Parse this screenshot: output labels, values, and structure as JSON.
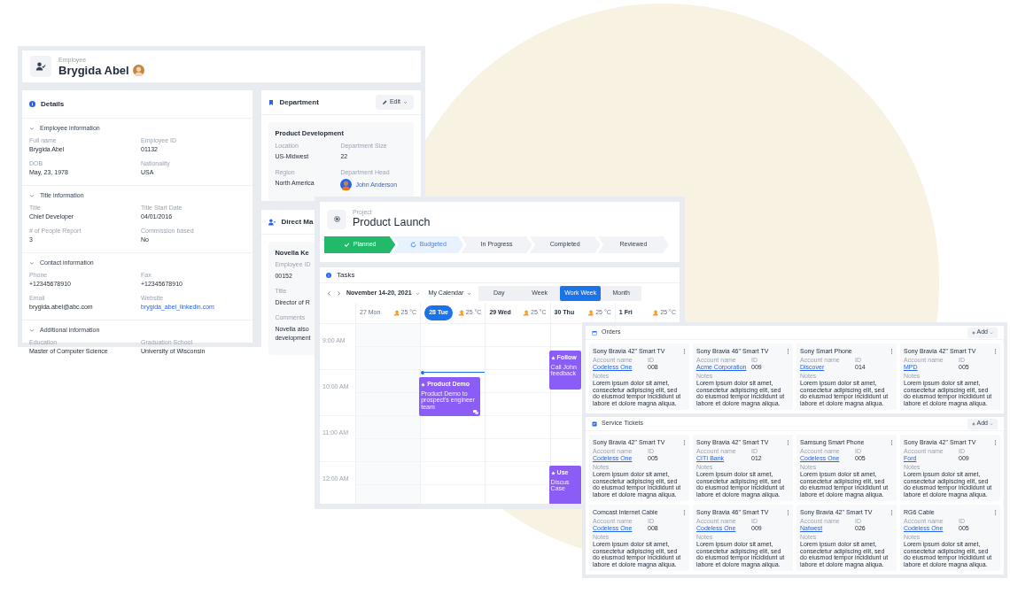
{
  "employee": {
    "label": "Employee",
    "name": "Brygida Abel",
    "details": {
      "title": "Details",
      "sections": [
        {
          "title": "Employee information",
          "expanded": true,
          "fields": [
            {
              "label": "Full name",
              "value": "Brygida Abel",
              "kind": "text"
            },
            {
              "label": "Employee ID",
              "value": "01132",
              "kind": "text"
            },
            {
              "label": "DOB",
              "value": "May, 23, 1978",
              "kind": "text"
            },
            {
              "label": "Nationality",
              "value": "USA",
              "kind": "text"
            }
          ]
        },
        {
          "title": "Title information",
          "expanded": true,
          "fields": [
            {
              "label": "Title",
              "value": "Chief Developer",
              "kind": "text"
            },
            {
              "label": "Title Start Date",
              "value": "04/01/2016",
              "kind": "text"
            },
            {
              "label": "# of People Report",
              "value": "3",
              "kind": "text"
            },
            {
              "label": "Commission based",
              "value": "No",
              "kind": "text"
            }
          ]
        },
        {
          "title": "Contact information",
          "expanded": true,
          "fields": [
            {
              "label": "Phone",
              "value": "+12345678910",
              "kind": "text"
            },
            {
              "label": "Fax",
              "value": "+12345678910",
              "kind": "text"
            },
            {
              "label": "Email",
              "value": "brygida.abel@abc.com",
              "kind": "text"
            },
            {
              "label": "Website",
              "value": "brygida_abel_linkedin.com",
              "kind": "link"
            }
          ]
        },
        {
          "title": "Additional information",
          "expanded": true,
          "fields": [
            {
              "label": "Education",
              "value": "Master of Computer Science",
              "kind": "text"
            },
            {
              "label": "Graduation School",
              "value": "University of Wisconsin",
              "kind": "text"
            }
          ]
        }
      ]
    },
    "department": {
      "title": "Department",
      "edit": "Edit",
      "name": "Product Development",
      "fields": [
        {
          "label": "Location",
          "value": "US-Midwest",
          "kind": "text"
        },
        {
          "label": "Department Size",
          "value": "22",
          "kind": "text"
        },
        {
          "label": "Region",
          "value": "North America",
          "kind": "text"
        },
        {
          "label": "Department Head",
          "value": "John Anderson",
          "kind": "person"
        }
      ]
    },
    "manager": {
      "title": "Direct Ma",
      "name": "Novella Ke",
      "fields": [
        {
          "label": "Employee ID",
          "value": "00152"
        },
        {
          "label": "Title",
          "value": "Director of R"
        },
        {
          "label": "Comments",
          "value": "Novella also development"
        }
      ]
    }
  },
  "project": {
    "label": "Project",
    "name": "Product Launch",
    "stages": [
      {
        "label": "Planned",
        "done": true,
        "current": false
      },
      {
        "label": "Budgeted",
        "done": false,
        "current": true
      },
      {
        "label": "In Progress",
        "done": false,
        "current": false
      },
      {
        "label": "Completed",
        "done": false,
        "current": false
      },
      {
        "label": "Reviewed",
        "done": false,
        "current": false
      }
    ],
    "tasks": {
      "title": "Tasks",
      "range": "November 14-20, 2021",
      "calendar": "My Calendar",
      "views": [
        {
          "label": "Day",
          "selected": false
        },
        {
          "label": "Week",
          "selected": false
        },
        {
          "label": "Work Week",
          "selected": true
        },
        {
          "label": "Month",
          "selected": false
        }
      ],
      "times": [
        "9:00 AM",
        "10:00 AM",
        "11:00 AM",
        "12:00 AM"
      ],
      "days": [
        {
          "label": "27 Mon",
          "today": false,
          "past": true,
          "weather": "25 °C"
        },
        {
          "label": "28 Tue",
          "today": true,
          "past": false,
          "weather": "25 °C",
          "events": [
            {
              "title": "Product Demo",
              "text": "Product Demo to prospect's engineer team",
              "chat": true
            }
          ]
        },
        {
          "label": "29 Wed",
          "today": false,
          "past": false,
          "weather": "25 °C"
        },
        {
          "label": "30 Thu",
          "today": false,
          "past": false,
          "weather": "25 °C",
          "events": [
            {
              "title": "Follow",
              "text": "Call John feedback",
              "chat": false
            },
            {
              "title": "Use",
              "text": "Discus Case",
              "chat": false
            }
          ]
        },
        {
          "label": "1 Fri",
          "today": false,
          "past": false,
          "weather": "25 °C"
        }
      ]
    }
  },
  "orders": {
    "title": "Orders",
    "add": "Add",
    "cards": [
      {
        "title": "Sony Bravia 42\" Smart TV",
        "account_label": "Account name",
        "id_label": "ID",
        "account": "Codeless One",
        "id": "008",
        "notes_label": "Notes",
        "notes": "Lorem ipsum dolor sit amet, consectetur adipiscing elit, sed do eiusmod tempor incididunt ut labore et dolore magna aliqua."
      },
      {
        "title": "Sony Bravia 46\" Smart TV",
        "account_label": "Account name",
        "id_label": "ID",
        "account": "Acme Corporation",
        "id": "009",
        "notes_label": "Notes",
        "notes": "Lorem ipsum dolor sit amet, consectetur adipiscing elit, sed do eiusmod tempor incididunt ut labore et dolore magna aliqua."
      },
      {
        "title": "Sony Smart Phone",
        "account_label": "Account name",
        "id_label": "ID",
        "account": "Discover",
        "id": "014",
        "notes_label": "Notes",
        "notes": "Lorem ipsum dolor sit amet, consectetur adipiscing elit, sed do eiusmod tempor incididunt ut labore et dolore magna aliqua."
      },
      {
        "title": "Sony Bravia 42\" Smart TV",
        "account_label": "Account name",
        "id_label": "ID",
        "account": "MPD",
        "id": "005",
        "notes_label": "Notes",
        "notes": "Lorem ipsum dolor sit amet, consectetur adipiscing elit, sed do eiusmod tempor incididunt ut labore et dolore magna aliqua."
      }
    ]
  },
  "service_tickets": {
    "title": "Service Tickets",
    "add": "Add",
    "cards": [
      {
        "title": "Sony Bravia 42\" Smart TV",
        "account_label": "Account name",
        "id_label": "ID",
        "account": "Codeless One",
        "id": "005",
        "notes_label": "Notes",
        "notes": "Lorem ipsum dolor sit amet, consectetur adipiscing elit, sed do eiusmod tempor incididunt ut labore et dolore magna aliqua."
      },
      {
        "title": "Sony Bravia 42\" Smart TV",
        "account_label": "Account name",
        "id_label": "ID",
        "account": "CITI Bank",
        "id": "012",
        "notes_label": "Notes",
        "notes": "Lorem ipsum dolor sit amet, consectetur adipiscing elit, sed do eiusmod tempor incididunt ut labore et dolore magna aliqua."
      },
      {
        "title": "Samsung Smart Phone",
        "account_label": "Account name",
        "id_label": "ID",
        "account": "Codeless One",
        "id": "005",
        "notes_label": "Notes",
        "notes": "Lorem ipsum dolor sit amet, consectetur adipiscing elit, sed do eiusmod tempor incididunt ut labore et dolore magna aliqua."
      },
      {
        "title": "Sony Bravia 42\" Smart TV",
        "account_label": "Account name",
        "id_label": "ID",
        "account": "Ford",
        "id": "009",
        "notes_label": "Notes",
        "notes": "Lorem ipsum dolor sit amet, consectetur adipiscing elit, sed do eiusmod tempor incididunt ut labore et dolore magna aliqua."
      },
      {
        "title": "Comcast Internet Cable",
        "account_label": "Account name",
        "id_label": "ID",
        "account": "Codeless One",
        "id": "008",
        "notes_label": "Notes",
        "notes": "Lorem ipsum dolor sit amet, consectetur adipiscing elit, sed do eiusmod tempor incididunt ut labore et dolore magna aliqua."
      },
      {
        "title": "Sony Bravia 46\" Smart TV",
        "account_label": "Account name",
        "id_label": "ID",
        "account": "Codeless One",
        "id": "009",
        "notes_label": "Notes",
        "notes": "Lorem ipsum dolor sit amet, consectetur adipiscing elit, sed do eiusmod tempor incididunt ut labore et dolore magna aliqua."
      },
      {
        "title": "Sony Bravia 42\" Smart TV",
        "account_label": "Account name",
        "id_label": "ID",
        "account": "Natwest",
        "id": "026",
        "notes_label": "Notes",
        "notes": "Lorem ipsum dolor sit amet, consectetur adipiscing elit, sed do eiusmod tempor incididunt ut labore et dolore magna aliqua."
      },
      {
        "title": "RG6 Cable",
        "account_label": "Account name",
        "id_label": "ID",
        "account": "Codeless One",
        "id": "005",
        "notes_label": "Notes",
        "notes": "Lorem ipsum dolor sit amet, consectetur adipiscing elit, sed do eiusmod tempor incididunt ut labore et dolore magna aliqua."
      }
    ]
  }
}
